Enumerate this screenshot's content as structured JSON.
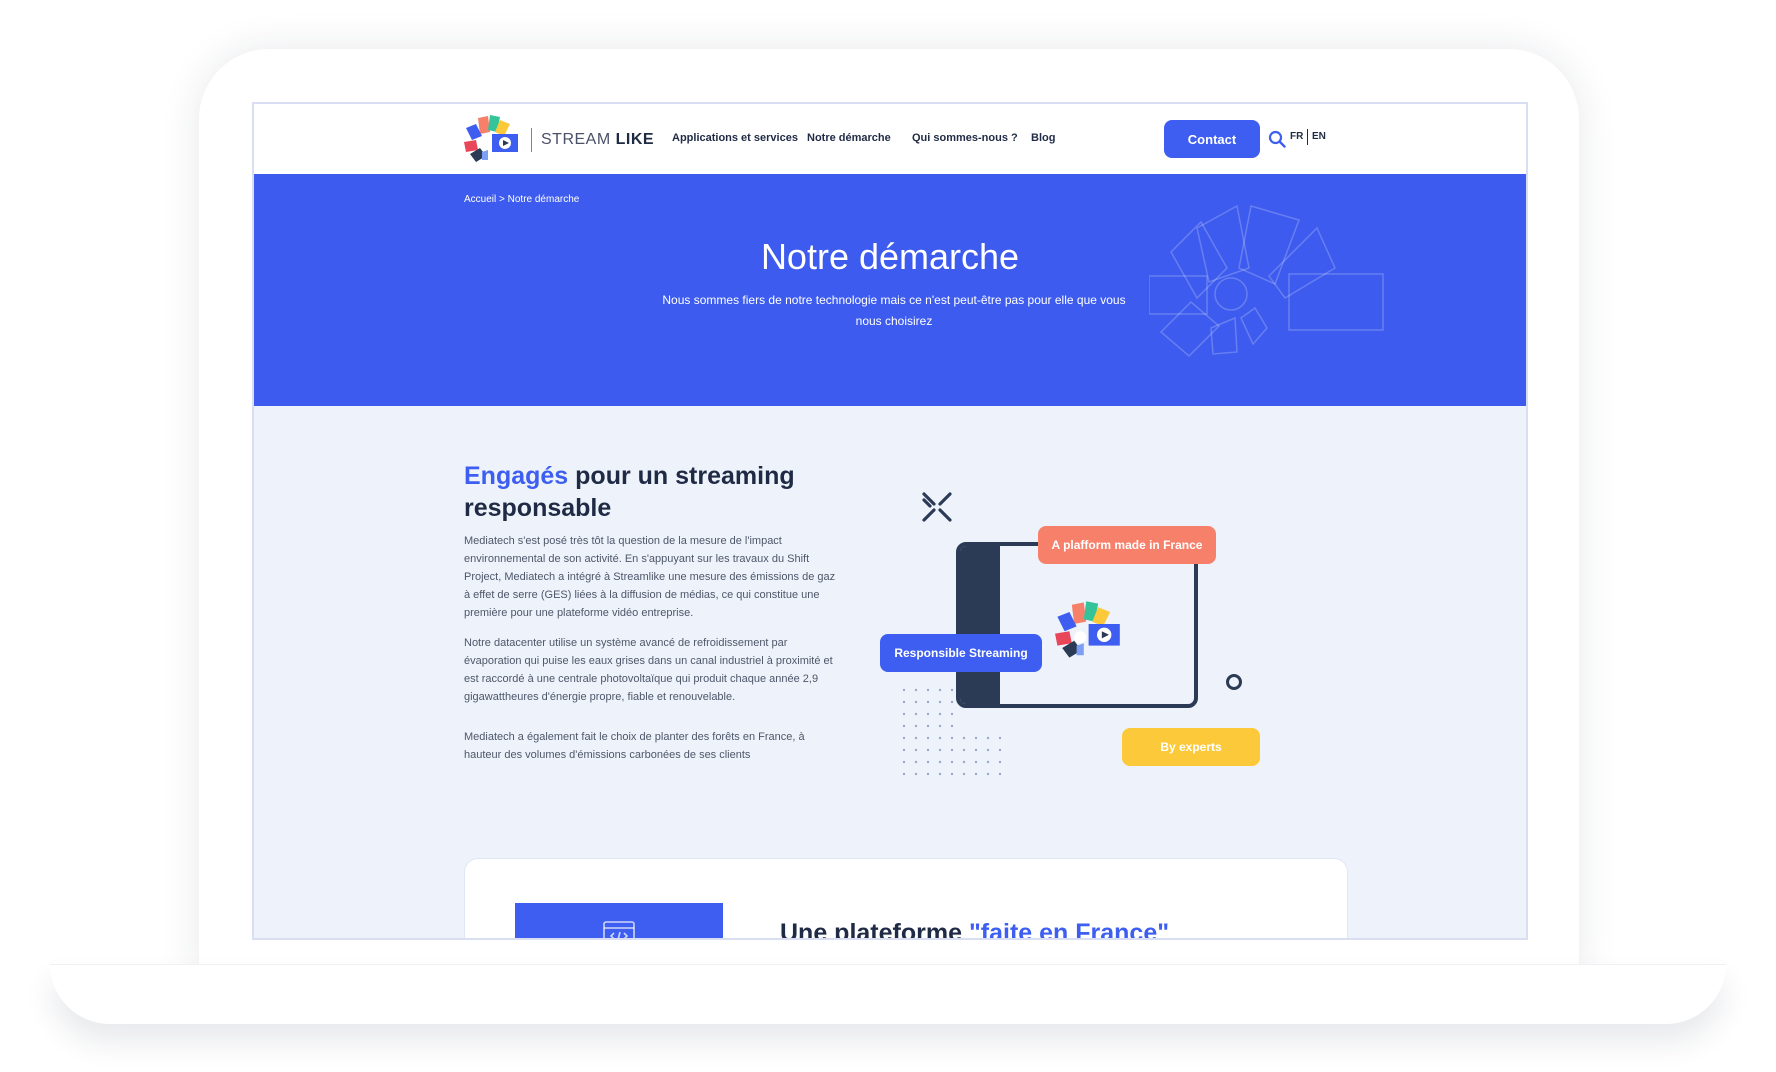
{
  "header": {
    "brand_light": "STREAM",
    "brand_bold": "LIKE",
    "nav": [
      "Applications et services",
      "Notre démarche",
      "Qui sommes-nous ?",
      "Blog"
    ],
    "contact": "Contact",
    "lang_fr": "FR",
    "lang_en": "EN"
  },
  "hero": {
    "breadcrumb": "Accueil > Notre démarche",
    "title": "Notre démarche",
    "subtitle": "Nous sommes fiers de notre technologie mais ce n'est peut-être pas pour elle que vous nous choisirez"
  },
  "section": {
    "title_accent": "Engagés",
    "title_rest": " pour un streaming responsable",
    "paragraphs": [
      "Mediatech s'est posé très tôt la question de la mesure de l'impact environnemental de son activité. En s'appuyant sur les travaux du Shift Project, Mediatech a intégré à Streamlike une mesure des émissions de gaz à effet de serre (GES) liées à la diffusion de médias, ce qui constitue une première pour une plateforme vidéo entreprise.",
      "Notre datacenter utilise un système avancé de refroidissement par évaporation qui puise les eaux grises dans un canal industriel à proximité et est raccordé à une centrale photovoltaïque qui produit chaque année 2,9 gigawattheures d'énergie propre, fiable et renouvelable.",
      "Mediatech a également fait le choix de planter des forêts en France, à hauteur des volumes d'émissions carbonées de ses clients"
    ]
  },
  "illustration": {
    "tag_france": "A plafform made in France",
    "tag_streaming": "Responsible Streaming",
    "tag_experts": "By experts"
  },
  "card": {
    "title_main": "Une plateforme ",
    "title_accent": "\"faite en France\""
  },
  "colors": {
    "primary": "#3d5ef0",
    "coral": "#f7806b",
    "yellow": "#fcc93a",
    "navy": "#2b3a55",
    "background": "#eef3fb"
  }
}
